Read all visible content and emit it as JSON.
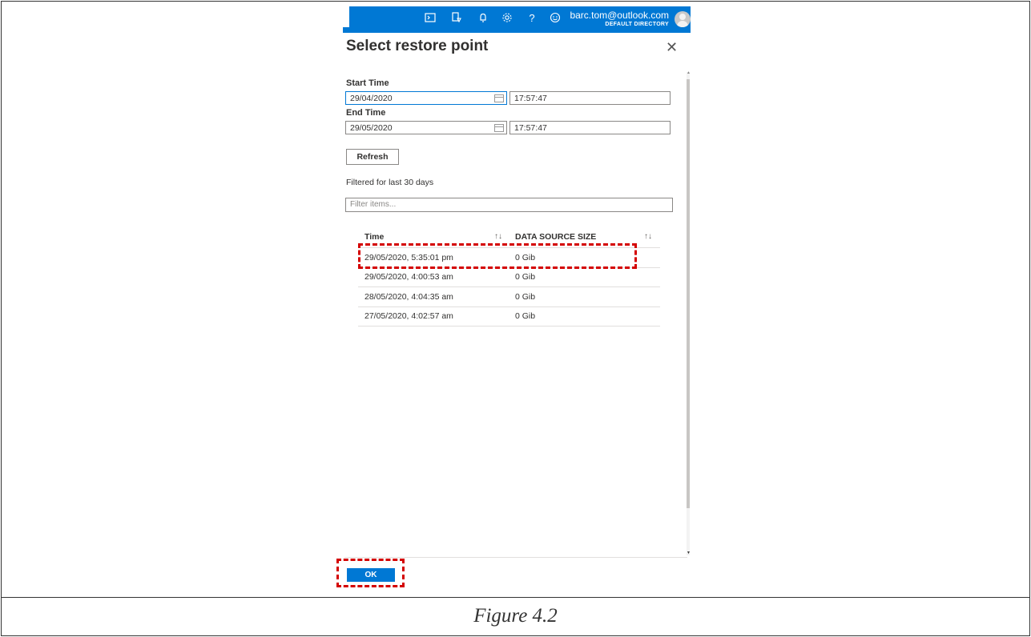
{
  "topbar": {
    "icons": [
      "cloud-shell-icon",
      "directory-filter-icon",
      "notifications-icon",
      "settings-icon",
      "help-icon",
      "feedback-icon"
    ],
    "user_email": "barc.tom@outlook.com",
    "user_directory": "DEFAULT DIRECTORY"
  },
  "panel": {
    "title": "Select restore point",
    "start_label": "Start Time",
    "start_date": "29/04/2020",
    "start_time": "17:57:47",
    "end_label": "End Time",
    "end_date": "29/05/2020",
    "end_time": "17:57:47",
    "refresh_label": "Refresh",
    "filter_info": "Filtered for last 30 days",
    "filter_placeholder": "Filter items..."
  },
  "table": {
    "col_time": "Time",
    "col_size": "DATA SOURCE SIZE",
    "rows": [
      {
        "time": "29/05/2020, 5:35:01 pm",
        "size": "0  Gib"
      },
      {
        "time": "29/05/2020, 4:00:53 am",
        "size": "0  Gib"
      },
      {
        "time": "28/05/2020, 4:04:35 am",
        "size": "0  Gib"
      },
      {
        "time": "27/05/2020, 4:02:57 am",
        "size": "0  Gib"
      }
    ]
  },
  "footer": {
    "ok_label": "OK"
  },
  "caption": "Figure 4.2",
  "colors": {
    "accent": "#0078d4",
    "highlight": "#d40000"
  }
}
